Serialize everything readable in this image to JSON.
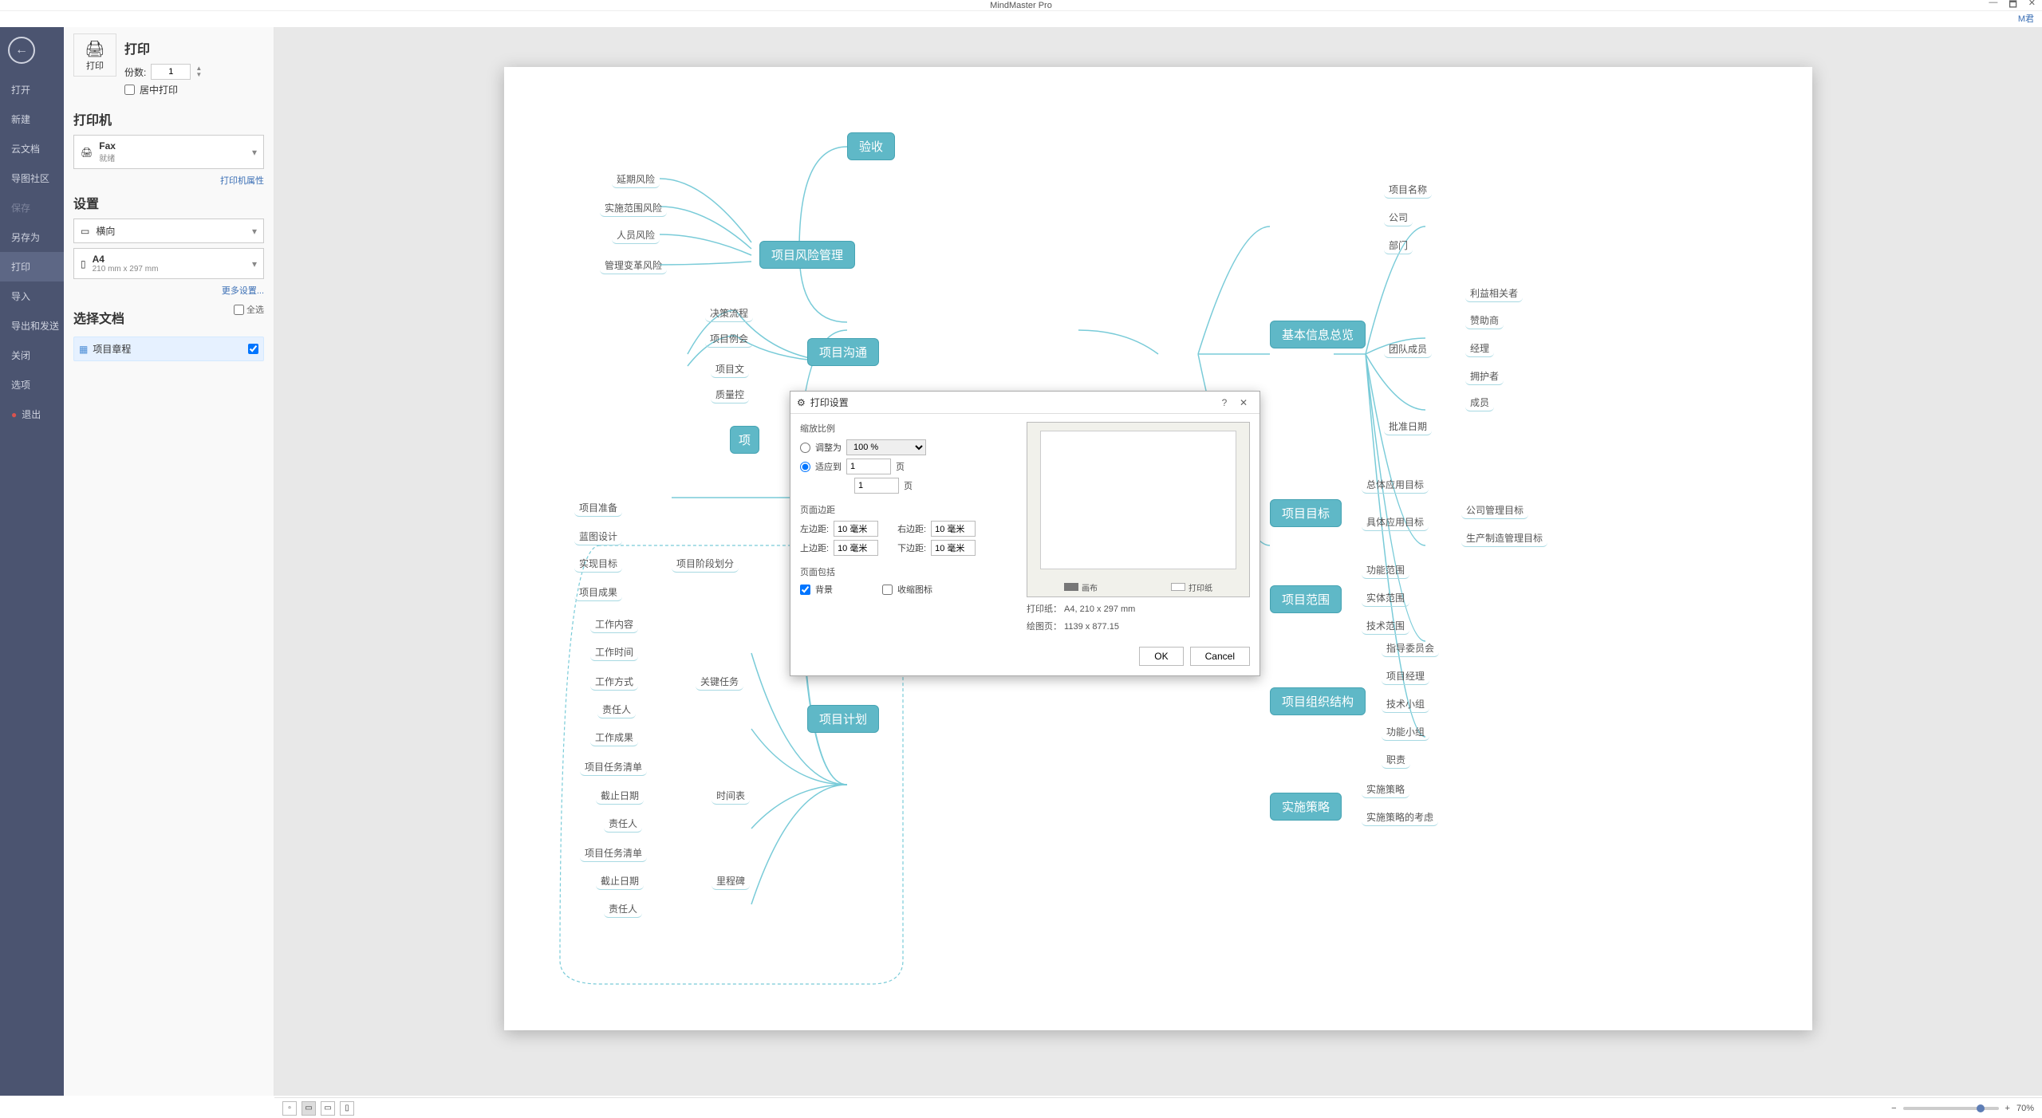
{
  "title": "MindMaster Pro",
  "account": "M君",
  "leftnav": {
    "back": "←",
    "items": [
      "打开",
      "新建",
      "云文档",
      "导图社区",
      "保存",
      "另存为",
      "打印",
      "导入",
      "导出和发送",
      "关闭",
      "选项",
      "退出"
    ]
  },
  "panel": {
    "print": "打印",
    "print_btn": "打印",
    "copies": "份数:",
    "copies_val": "1",
    "center_print": "居中打印",
    "printer": "打印机",
    "printer_name": "Fax",
    "printer_status": "就绪",
    "printer_props": "打印机属性",
    "settings": "设置",
    "orientation": "横向",
    "paper": "A4",
    "paper_sub": "210 mm x 297 mm",
    "more": "更多设置...",
    "select_doc": "选择文档",
    "select_all": "全选",
    "doc_name": "项目章程"
  },
  "dialog": {
    "title": "打印设置",
    "scale": "缩放比例",
    "adjust_to": "调整为",
    "adjust_val": "100 %",
    "fit_to": "适应到",
    "fit_x": "1",
    "fit_y": "1",
    "page_unit": "页",
    "margins": "页面边距",
    "left": "左边距:",
    "right": "右边距:",
    "top": "上边距:",
    "bottom": "下边距:",
    "margin_val": "10 毫米",
    "include": "页面包括",
    "background": "背景",
    "collapse_icon": "收缩图标",
    "legend_canvas": "画布",
    "legend_paper": "打印纸",
    "paper_info": "打印纸： A4, 210 x 297 mm",
    "draw_info": "绘图页： 1139 x 877.15",
    "ok": "OK",
    "cancel": "Cancel"
  },
  "status": {
    "zoom": "70%"
  },
  "mindmap": {
    "n1": "验收",
    "n2": "项目风险管理",
    "n2a": "延期风险",
    "n2b": "实施范围风险",
    "n2c": "人员风险",
    "n2d": "管理变革风险",
    "n3": "项目沟通",
    "n3a": "决策流程",
    "n3b": "项目例会",
    "n3c": "项目文",
    "n3d": "质量控",
    "n4": "项",
    "n5": "基本信息总览",
    "n5a": "项目名称",
    "n5b": "公司",
    "n5c": "部门",
    "n5d": "团队成员",
    "n5e": "批准日期",
    "n5d1": "利益相关者",
    "n5d2": "赞助商",
    "n5d3": "经理",
    "n5d4": "拥护者",
    "n5d5": "成员",
    "n6": "项目目标",
    "n6a": "总体应用目标",
    "n6b": "具体应用目标",
    "n6b1": "公司管理目标",
    "n6b2": "生产制造管理目标",
    "n7": "项目范围",
    "n7a": "功能范围",
    "n7b": "实体范围",
    "n7c": "技术范围",
    "n8": "项目组织结构",
    "n8a": "指导委员会",
    "n8b": "项目经理",
    "n8c": "技术小组",
    "n8d": "功能小组",
    "n8e": "职责",
    "n9": "实施策略",
    "n9a": "实施策略",
    "n9b": "实施策略的考虑",
    "n10": "项目计划",
    "n10a": "项目阶段划分",
    "n10a1": "项目准备",
    "n10a2": "蓝图设计",
    "n10a3": "实现目标",
    "n10a4": "项目成果",
    "n10b": "关键任务",
    "n10b1": "工作内容",
    "n10b2": "工作时间",
    "n10b3": "工作方式",
    "n10b4": "责任人",
    "n10b5": "工作成果",
    "n10c": "时间表",
    "n10c1": "项目任务清单",
    "n10c2": "截止日期",
    "n10c3": "责任人",
    "n10d": "里程碑",
    "n10d1": "项目任务清单",
    "n10d2": "截止日期",
    "n10d3": "责任人"
  }
}
